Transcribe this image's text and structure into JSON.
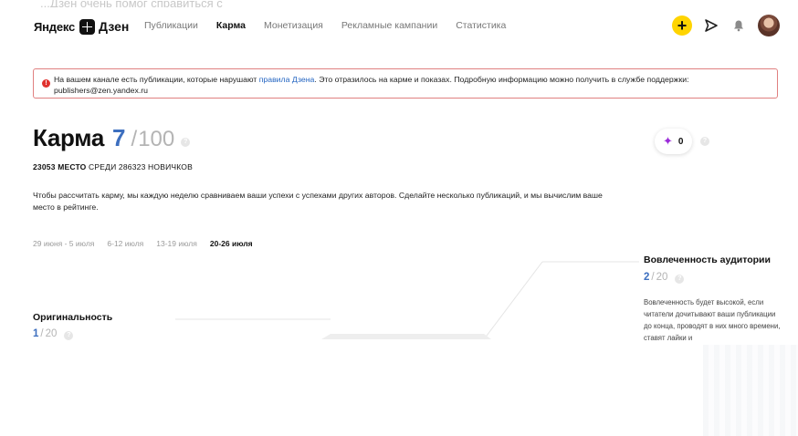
{
  "header": {
    "top_cut_text": "...Дзен очень помог справиться с",
    "logo_brand": "Яндекс",
    "logo_product": "Дзен",
    "nav": [
      {
        "label": "Публикации",
        "active": false
      },
      {
        "label": "Карма",
        "active": true
      },
      {
        "label": "Монетизация",
        "active": false
      },
      {
        "label": "Рекламные кампании",
        "active": false
      },
      {
        "label": "Статистика",
        "active": false
      }
    ],
    "icons": [
      "plus-icon",
      "send-icon",
      "bell-icon",
      "avatar"
    ],
    "plus_glyph": "+"
  },
  "alert": {
    "text_before": "На вашем канале есть публикации, которые нарушают ",
    "link": "правила Дзена",
    "text_after": ". Это отразилось на карме и показах. Подробную информацию можно получить в службе поддержки:",
    "email": "publishers@zen.yandex.ru",
    "icon_glyph": "!"
  },
  "karma": {
    "title": "Карма",
    "score": "7",
    "slash": "/",
    "total": "100",
    "help_glyph": "?",
    "rank_place": "23053 МЕСТО",
    "rank_rest": " СРЕДИ 286323 НОВИЧКОВ",
    "description": "Чтобы рассчитать карму, мы каждую неделю сравниваем ваши успехи с успехами других авторов. Сделайте несколько публикаций, и мы вычислим ваше место в рейтинге.",
    "weeks": [
      {
        "label": "29 июня - 5 июля",
        "active": false
      },
      {
        "label": "6-12 июля",
        "active": false
      },
      {
        "label": "13-19 июля",
        "active": false
      },
      {
        "label": "20-26 июля",
        "active": true
      }
    ]
  },
  "stars": {
    "count": "0",
    "glyph": "✦"
  },
  "metrics": {
    "originality": {
      "title": "Оригинальность",
      "value": "1",
      "sep": "/",
      "total": "20"
    },
    "engagement": {
      "title": "Вовлеченность аудитории",
      "value": "2",
      "sep": "/",
      "total": "20",
      "text": "Вовлеченность будет высокой, если читатели дочитывают ваши публикации до конца, проводят в них много времени, ставят лайки и"
    }
  },
  "colors": {
    "accent_blue": "#3d6fbf",
    "link_blue": "#2566c2",
    "alert_border": "#e08080",
    "alert_icon": "#e0322e",
    "plus_yellow": "#ffd400",
    "star_purple": "#9b2bd9"
  }
}
